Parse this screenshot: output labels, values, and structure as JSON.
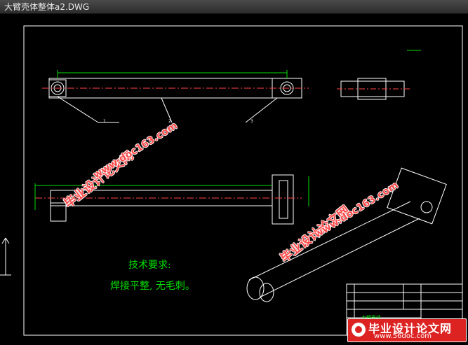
{
  "window": {
    "title": "大臂壳体整体a2.DWG"
  },
  "drawing": {
    "tech_req_title": "技术要求:",
    "tech_req_body": "焊接平整, 无毛刺。",
    "part_name": "大臂壳体",
    "balloon_1": "1",
    "balloon_2": "2",
    "balloon_3": "3"
  },
  "watermarks": {
    "brand": "毕业设计论文网",
    "url": "www.doc163.com"
  },
  "badge": {
    "brand": "毕业设计论文网",
    "url": "www.56doc.com"
  },
  "colors": {
    "title_bg": "#2c2c2c",
    "canvas_bg": "#000000",
    "line": "#ffffff",
    "dimension": "#00e000",
    "watermark": "#ff4a4a",
    "badge_bg": "#dd2222"
  }
}
